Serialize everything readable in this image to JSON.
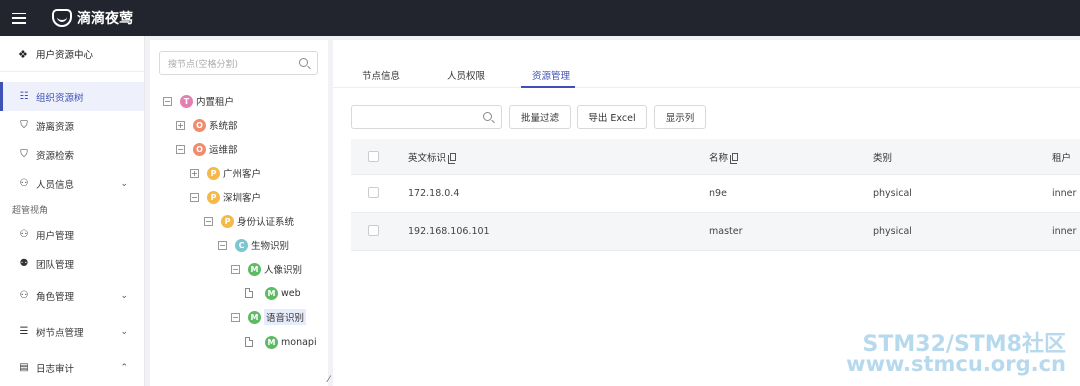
{
  "app": {
    "logo_text": "滴滴夜莺"
  },
  "sidebar": {
    "header": "用户资源中心",
    "items": [
      {
        "label": "组织资源树",
        "icon": "tree-icon"
      },
      {
        "label": "游离资源",
        "icon": "shield-icon"
      },
      {
        "label": "资源检索",
        "icon": "search-box-icon"
      },
      {
        "label": "人员信息",
        "icon": "user-icon"
      }
    ],
    "group_label": "超管视角",
    "admin_items": [
      {
        "label": "用户管理",
        "icon": "user-manage-icon"
      },
      {
        "label": "团队管理",
        "icon": "team-icon"
      },
      {
        "label": "角色管理",
        "icon": "role-icon"
      },
      {
        "label": "树节点管理",
        "icon": "sliders-icon"
      },
      {
        "label": "日志审计",
        "icon": "log-icon"
      }
    ]
  },
  "tree": {
    "search_placeholder": "搜节点(空格分割)",
    "nodes": [
      {
        "label": "内置租户",
        "badge": "T",
        "color": "#e57fb3"
      },
      {
        "label": "系统部",
        "badge": "O",
        "color": "#f08c6e"
      },
      {
        "label": "运维部",
        "badge": "O",
        "color": "#f08c6e"
      },
      {
        "label": "广州客户",
        "badge": "P",
        "color": "#f5b84a"
      },
      {
        "label": "深圳客户",
        "badge": "P",
        "color": "#f5b84a"
      },
      {
        "label": "身份认证系统",
        "badge": "P",
        "color": "#f5b84a"
      },
      {
        "label": "生物识别",
        "badge": "C",
        "color": "#7cc6cf"
      },
      {
        "label": "人像识别",
        "badge": "M",
        "color": "#5dbb63"
      },
      {
        "label": "web",
        "badge": "M",
        "color": "#5dbb63"
      },
      {
        "label": "语音识别",
        "badge": "M",
        "color": "#5dbb63"
      },
      {
        "label": "monapi",
        "badge": "M",
        "color": "#5dbb63"
      }
    ]
  },
  "main": {
    "tabs": [
      {
        "label": "节点信息"
      },
      {
        "label": "人员权限"
      },
      {
        "label": "资源管理"
      }
    ],
    "active_tab": "资源管理",
    "buttons": {
      "batch_filter": "批量过滤",
      "export_excel": "导出 Excel",
      "show_columns": "显示列"
    },
    "columns": [
      "英文标识",
      "名称",
      "类别",
      "租户"
    ],
    "rows": [
      {
        "ident": "172.18.0.4",
        "name": "n9e",
        "category": "physical",
        "tenant": "inner"
      },
      {
        "ident": "192.168.106.101",
        "name": "master",
        "category": "physical",
        "tenant": "inner"
      }
    ]
  },
  "watermark": {
    "line1": "STM32/STM8社区",
    "line2": "www.stmcu.org.cn"
  },
  "colors": {
    "accent": "#3f51b5",
    "topbar": "#22252e"
  }
}
